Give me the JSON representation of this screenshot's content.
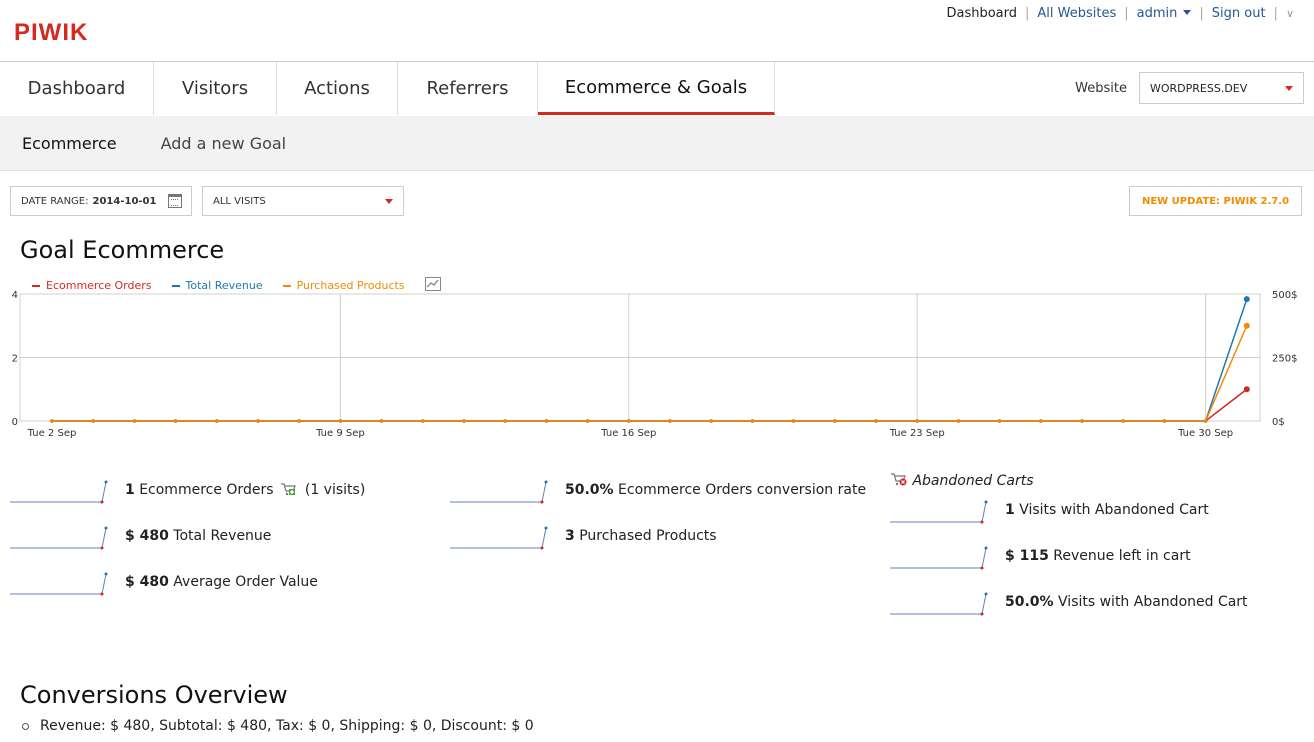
{
  "logo": "PIWIK",
  "topnav": {
    "dashboard": "Dashboard",
    "all_websites": "All Websites",
    "user": "admin",
    "sign_out": "Sign out"
  },
  "mainnav": {
    "tabs": [
      "Dashboard",
      "Visitors",
      "Actions",
      "Referrers",
      "Ecommerce & Goals"
    ],
    "active_index": 4
  },
  "website_selector": {
    "label": "Website",
    "value": "WORDPRESS.DEV"
  },
  "subnav": {
    "items": [
      "Ecommerce",
      "Add a new Goal"
    ]
  },
  "controls": {
    "date_range_label": "DATE RANGE:",
    "date_range_value": "2014-10-01",
    "segment": "ALL VISITS",
    "update": "NEW UPDATE: PIWIK 2.7.0"
  },
  "section_title": "Goal Ecommerce",
  "colors": {
    "orders": "#d4291f",
    "revenue": "#1f78b4",
    "products": "#f38b00",
    "accent": "#d4291f",
    "link": "#255792"
  },
  "chart_data": {
    "type": "line",
    "x": [
      "2014-09-02",
      "2014-09-03",
      "2014-09-04",
      "2014-09-05",
      "2014-09-06",
      "2014-09-07",
      "2014-09-08",
      "2014-09-09",
      "2014-09-10",
      "2014-09-11",
      "2014-09-12",
      "2014-09-13",
      "2014-09-14",
      "2014-09-15",
      "2014-09-16",
      "2014-09-17",
      "2014-09-18",
      "2014-09-19",
      "2014-09-20",
      "2014-09-21",
      "2014-09-22",
      "2014-09-23",
      "2014-09-24",
      "2014-09-25",
      "2014-09-26",
      "2014-09-27",
      "2014-09-28",
      "2014-09-29",
      "2014-09-30",
      "2014-10-01"
    ],
    "xticks": [
      "Tue 2 Sep",
      "Tue 9 Sep",
      "Tue 16 Sep",
      "Tue 23 Sep",
      "Tue 30 Sep"
    ],
    "y_left": {
      "ticks": [
        "0",
        "2",
        "4"
      ],
      "ylim": [
        0,
        4
      ]
    },
    "y_right": {
      "ticks": [
        "0$",
        "250$",
        "500$"
      ],
      "ylim": [
        0,
        500
      ]
    },
    "grid": true,
    "legend": "top-left",
    "series": [
      {
        "name": "Ecommerce Orders",
        "axis": "left",
        "values": [
          0,
          0,
          0,
          0,
          0,
          0,
          0,
          0,
          0,
          0,
          0,
          0,
          0,
          0,
          0,
          0,
          0,
          0,
          0,
          0,
          0,
          0,
          0,
          0,
          0,
          0,
          0,
          0,
          0,
          1
        ]
      },
      {
        "name": "Total Revenue",
        "axis": "right",
        "values": [
          0,
          0,
          0,
          0,
          0,
          0,
          0,
          0,
          0,
          0,
          0,
          0,
          0,
          0,
          0,
          0,
          0,
          0,
          0,
          0,
          0,
          0,
          0,
          0,
          0,
          0,
          0,
          0,
          0,
          480
        ]
      },
      {
        "name": "Purchased Products",
        "axis": "left",
        "values": [
          0,
          0,
          0,
          0,
          0,
          0,
          0,
          0,
          0,
          0,
          0,
          0,
          0,
          0,
          0,
          0,
          0,
          0,
          0,
          0,
          0,
          0,
          0,
          0,
          0,
          0,
          0,
          0,
          0,
          3
        ]
      }
    ]
  },
  "metrics": {
    "orders_value": "1",
    "orders_label": "Ecommerce Orders",
    "orders_visits": "(1 visits)",
    "revenue_value": "$ 480",
    "revenue_label": "Total Revenue",
    "aov_value": "$ 480",
    "aov_label": "Average Order Value",
    "conv_value": "50.0%",
    "conv_label": "Ecommerce Orders conversion rate",
    "products_value": "3",
    "products_label": "Purchased Products"
  },
  "abandoned": {
    "title": "Abandoned Carts",
    "visits_value": "1",
    "visits_label": "Visits with Abandoned Cart",
    "revenue_value": "$ 115",
    "revenue_label": "Revenue left in cart",
    "rate_value": "50.0%",
    "rate_label": "Visits with Abandoned Cart"
  },
  "conversions": {
    "title": "Conversions Overview",
    "line": "Revenue: $ 480, Subtotal: $ 480, Tax: $ 0, Shipping: $ 0, Discount: $ 0"
  }
}
